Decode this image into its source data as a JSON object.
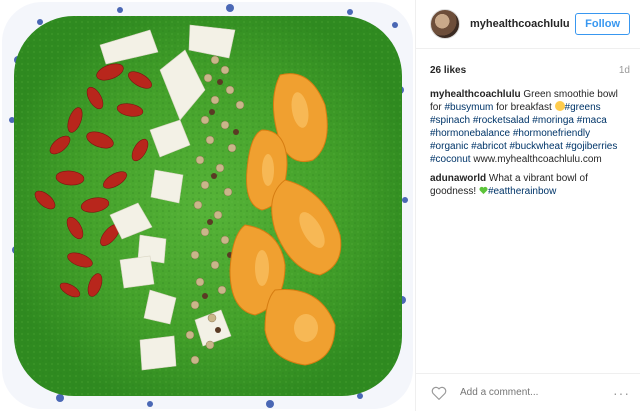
{
  "post": {
    "image_alt": "Green smoothie bowl",
    "header": {
      "username": "myhealthcoachlulu",
      "follow_label": "Follow"
    },
    "likes": "26 likes",
    "time": "1d",
    "caption": {
      "user": "myhealthcoachlulu",
      "text_1": "Green smoothie bowl for",
      "tag_busymum": "#busymum",
      "text_2": "for breakfast",
      "tags": [
        "#greens",
        "#spinach",
        "#rocketsalad",
        "#moringa",
        "#maca",
        "#hormonebalance",
        "#hormonefriendly",
        "#organic",
        "#abricot",
        "#buckwheat",
        "#gojiberries",
        "#coconut"
      ],
      "url": "www.myhealthcoachlulu.com"
    },
    "comment_2": {
      "user": "adunaworld",
      "text": "What a vibrant bowl of goodness!",
      "tag": "#eattherainbow"
    },
    "footer": {
      "placeholder": "Add a comment...",
      "more": "···"
    }
  },
  "colors": {
    "follow_blue": "#3897f0",
    "hashtag": "#003569",
    "smoothie_green": "#3fa62a",
    "goji_red": "#b8261c",
    "apricot": "#f0a030"
  }
}
